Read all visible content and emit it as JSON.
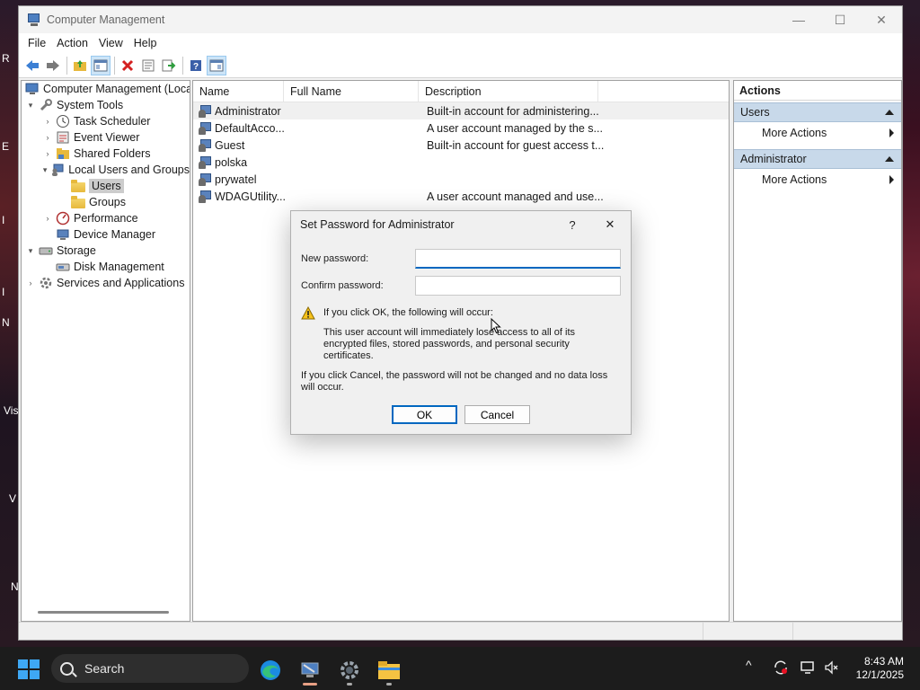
{
  "window": {
    "title": "Computer Management",
    "controls": {
      "minimize": "—",
      "maximize": "☐",
      "close": "✕"
    }
  },
  "menu": [
    "File",
    "Action",
    "View",
    "Help"
  ],
  "tree": [
    {
      "label": "Computer Management (Local",
      "level": 0,
      "twisty": "",
      "icon": "computer-management-icon"
    },
    {
      "label": "System Tools",
      "level": 1,
      "twisty": "v",
      "icon": "tools-icon"
    },
    {
      "label": "Task Scheduler",
      "level": 2,
      "twisty": ">",
      "icon": "clock-icon"
    },
    {
      "label": "Event Viewer",
      "level": 2,
      "twisty": ">",
      "icon": "event-viewer-icon"
    },
    {
      "label": "Shared Folders",
      "level": 2,
      "twisty": ">",
      "icon": "shared-folder-icon"
    },
    {
      "label": "Local Users and Groups",
      "level": 2,
      "twisty": "v",
      "icon": "users-icon"
    },
    {
      "label": "Users",
      "level": 3,
      "twisty": "",
      "icon": "folder-icon",
      "selected": true
    },
    {
      "label": "Groups",
      "level": 3,
      "twisty": "",
      "icon": "folder-icon"
    },
    {
      "label": "Performance",
      "level": 2,
      "twisty": ">",
      "icon": "performance-icon"
    },
    {
      "label": "Device Manager",
      "level": 2,
      "twisty": "",
      "icon": "device-manager-icon"
    },
    {
      "label": "Storage",
      "level": 1,
      "twisty": "v",
      "icon": "storage-icon"
    },
    {
      "label": "Disk Management",
      "level": 2,
      "twisty": "",
      "icon": "disk-icon"
    },
    {
      "label": "Services and Applications",
      "level": 1,
      "twisty": ">",
      "icon": "services-icon"
    }
  ],
  "list": {
    "columns": [
      "Name",
      "Full Name",
      "Description"
    ],
    "rows": [
      {
        "name": "Administrator",
        "full_name": "",
        "description": "Built-in account for administering..."
      },
      {
        "name": "DefaultAcco...",
        "full_name": "",
        "description": "A user account managed by the s..."
      },
      {
        "name": "Guest",
        "full_name": "",
        "description": "Built-in account for guest access t..."
      },
      {
        "name": "polska",
        "full_name": "",
        "description": ""
      },
      {
        "name": "prywatel",
        "full_name": "",
        "description": ""
      },
      {
        "name": "WDAGUtility...",
        "full_name": "",
        "description": "A user account managed and use..."
      }
    ]
  },
  "actions": {
    "title": "Actions",
    "sections": [
      {
        "label": "Users",
        "items": [
          "More Actions"
        ]
      },
      {
        "label": "Administrator",
        "items": [
          "More Actions"
        ]
      }
    ]
  },
  "dialog": {
    "title": "Set Password for Administrator",
    "help": "?",
    "close": "✕",
    "new_password_label": "New password:",
    "new_password_value": "",
    "confirm_password_label": "Confirm password:",
    "confirm_password_value": "",
    "warning_heading": "If you click OK, the following will occur:",
    "warning_body": "This user account will immediately lose access to all of its encrypted files, stored passwords, and personal security certificates.",
    "cancel_note": "If you click Cancel, the password will not be changed and no data loss will occur.",
    "ok_label": "OK",
    "cancel_label": "Cancel"
  },
  "taskbar": {
    "search_label": "Search",
    "time": "8:43 AM",
    "date": "12/1/2025",
    "tray_chevron": "^"
  },
  "desktop_fragments": [
    "R",
    "E",
    "I",
    "I",
    "N",
    "Vis",
    "V",
    "N"
  ],
  "colors": {
    "accent": "#0067c0",
    "action_section_bg": "#c8d9ea",
    "taskbar_bg": "#1c1c1c"
  }
}
